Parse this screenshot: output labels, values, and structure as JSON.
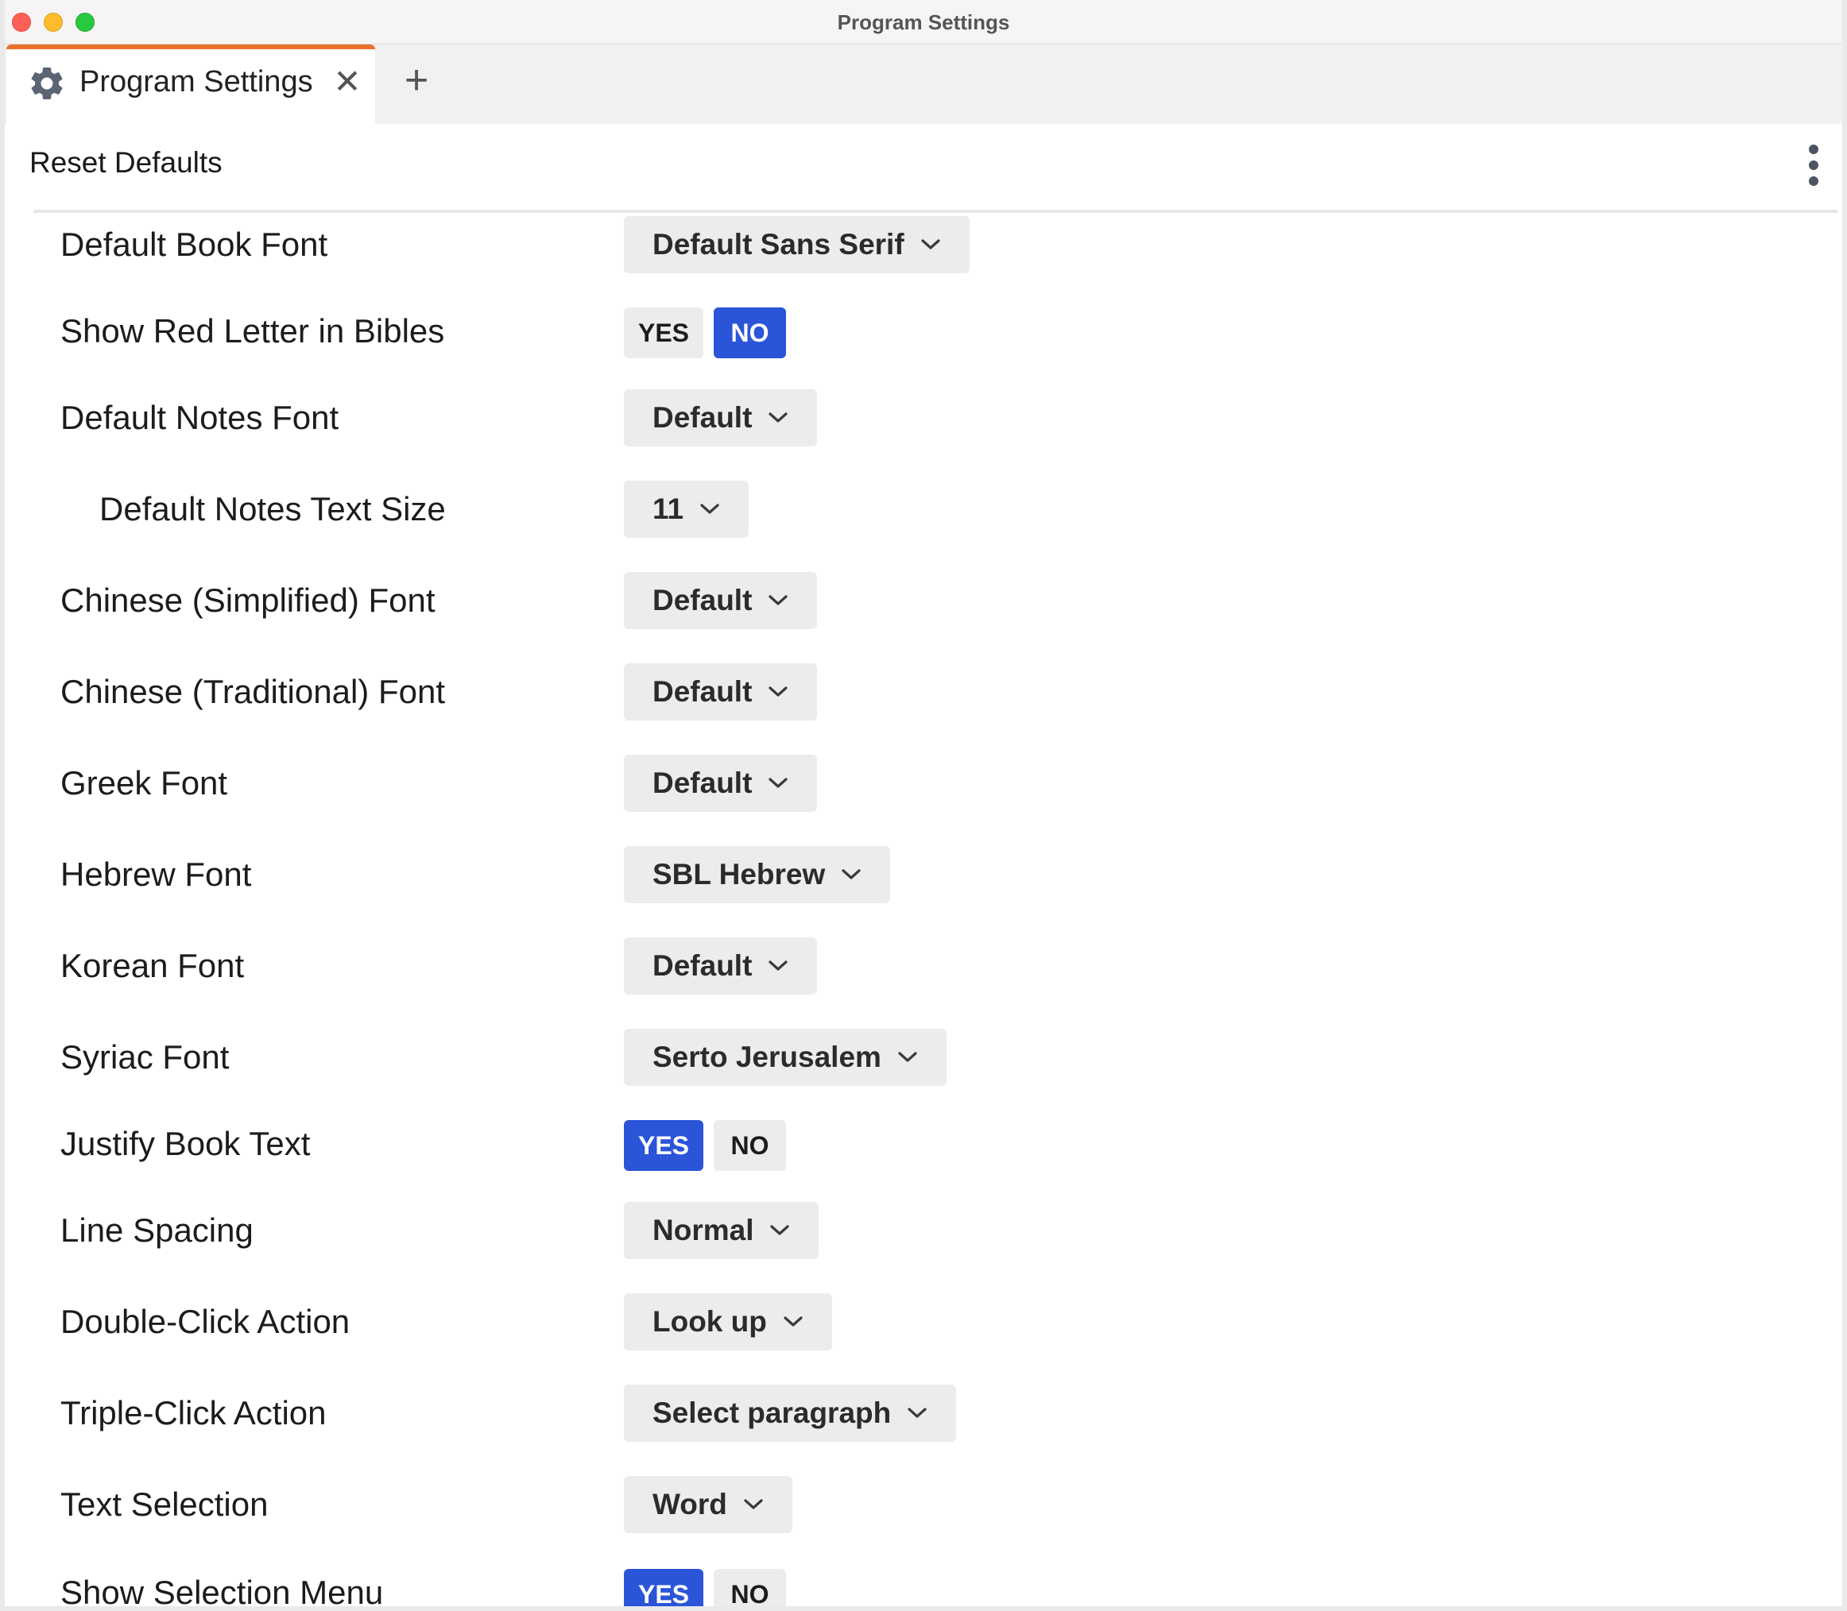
{
  "window": {
    "title": "Program Settings"
  },
  "tab": {
    "label": "Program Settings",
    "icon": "gear-icon",
    "accent_color": "#e8722a"
  },
  "toolbar": {
    "reset_label": "Reset Defaults"
  },
  "colors": {
    "active_toggle": "#2a55d8",
    "control_bg": "#ececec"
  },
  "settings": [
    {
      "label": "Default Book Font",
      "type": "dropdown",
      "value": "Default Sans Serif"
    },
    {
      "label": "Show Red Letter in Bibles",
      "type": "toggle",
      "yes_label": "YES",
      "no_label": "NO",
      "selected": "NO"
    },
    {
      "label": "Default Notes Font",
      "type": "dropdown",
      "value": "Default"
    },
    {
      "label": "Default Notes Text Size",
      "type": "dropdown",
      "value": "11",
      "indented": true
    },
    {
      "label": "Chinese (Simplified) Font",
      "type": "dropdown",
      "value": "Default"
    },
    {
      "label": "Chinese (Traditional) Font",
      "type": "dropdown",
      "value": "Default"
    },
    {
      "label": "Greek Font",
      "type": "dropdown",
      "value": "Default"
    },
    {
      "label": "Hebrew Font",
      "type": "dropdown",
      "value": "SBL Hebrew"
    },
    {
      "label": "Korean Font",
      "type": "dropdown",
      "value": "Default"
    },
    {
      "label": "Syriac Font",
      "type": "dropdown",
      "value": "Serto Jerusalem"
    },
    {
      "label": "Justify Book Text",
      "type": "toggle",
      "yes_label": "YES",
      "no_label": "NO",
      "selected": "YES"
    },
    {
      "label": "Line Spacing",
      "type": "dropdown",
      "value": "Normal"
    },
    {
      "label": "Double-Click Action",
      "type": "dropdown",
      "value": "Look up"
    },
    {
      "label": "Triple-Click Action",
      "type": "dropdown",
      "value": "Select paragraph"
    },
    {
      "label": "Text Selection",
      "type": "dropdown",
      "value": "Word"
    },
    {
      "label": "Show Selection Menu",
      "type": "toggle",
      "yes_label": "YES",
      "no_label": "NO",
      "selected": "YES"
    }
  ]
}
